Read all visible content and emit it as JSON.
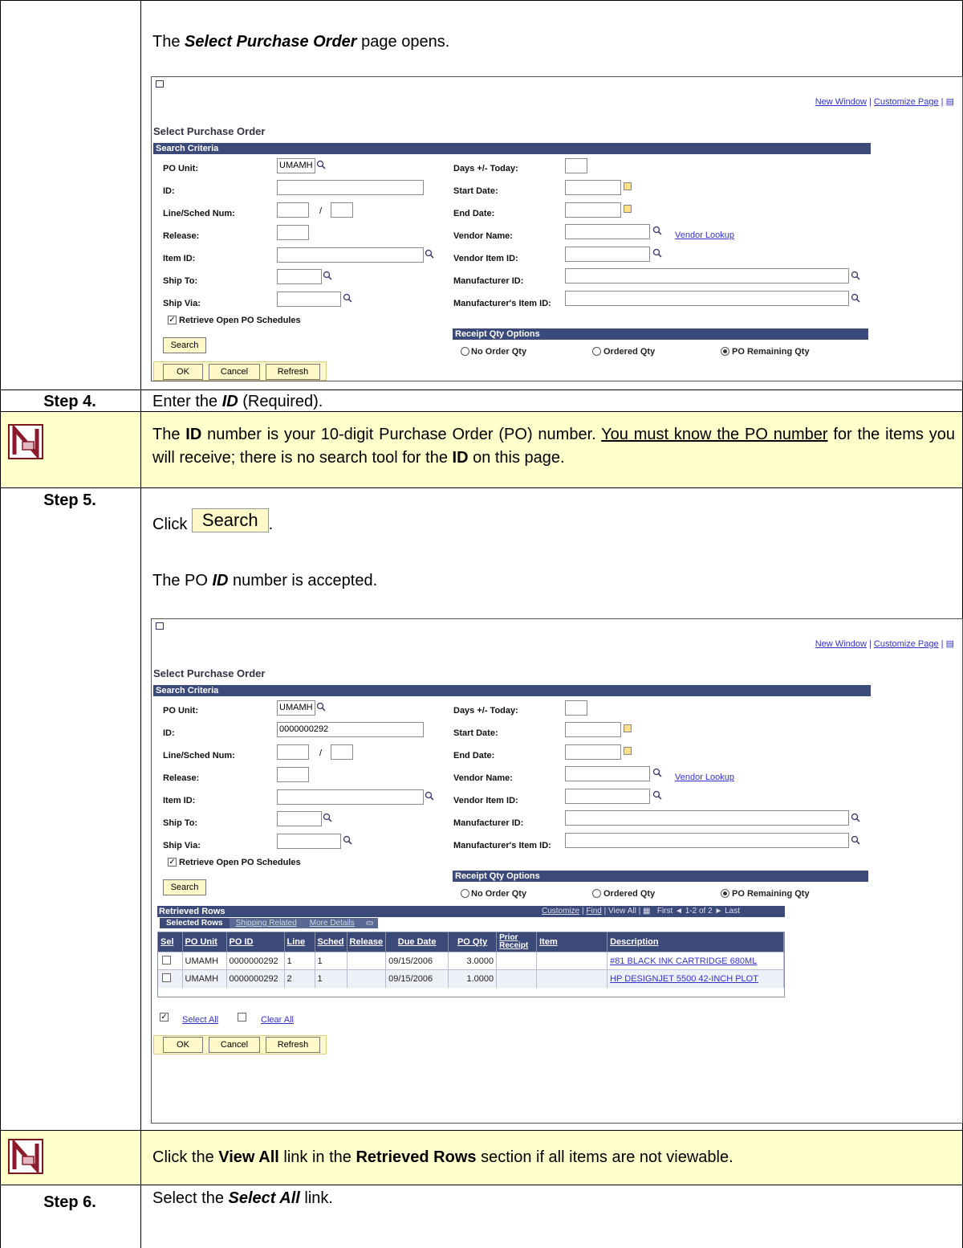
{
  "step3": {
    "intro_pre": "The ",
    "intro_em": "Select Purchase Order",
    "intro_post": " page opens."
  },
  "step4": {
    "label": "Step 4.",
    "pre": "Enter the ",
    "em": "ID",
    "post": " (Required)."
  },
  "note1": {
    "a": "The ",
    "b": "ID",
    "c": " number is your 10-digit Purchase Order (PO) number.  ",
    "d": "You must know the PO number",
    "e": " for the items you will receive; there is no search tool for the ",
    "f": "ID",
    "g": " on this page."
  },
  "step5": {
    "label": "Step 5.",
    "click": "Click ",
    "button": "Search",
    "period": ".",
    "accepted_pre": "The PO ",
    "accepted_em": "ID",
    "accepted_post": " number is accepted."
  },
  "note2": {
    "a": "Click the ",
    "b": "View All",
    "c": " link in the ",
    "d": "Retrieved Rows",
    "e": " section if all items are not viewable."
  },
  "step6": {
    "label": "Step 6.",
    "pre": "Select the ",
    "em": "Select All",
    "post": " link."
  },
  "ps": {
    "new_window": "New Window",
    "customize_page": "Customize Page",
    "sep": "|",
    "title": "Select Purchase Order",
    "search_criteria": "Search Criteria",
    "po_unit_label": "PO Unit:",
    "po_unit_value": "UMAMH",
    "id_label": "ID:",
    "id_value_1": "",
    "id_value_2": "0000000292",
    "line_sched_label": "Line/Sched Num:",
    "slash": "/",
    "release_label": "Release:",
    "item_id_label": "Item ID:",
    "ship_to_label": "Ship To:",
    "ship_via_label": "Ship Via:",
    "retrieve_open": "Retrieve Open PO Schedules",
    "days_label": "Days +/- Today:",
    "start_label": "Start Date:",
    "end_label": "End Date:",
    "vendor_name_label": "Vendor Name:",
    "vendor_lookup": "Vendor Lookup",
    "vendor_item_label": "Vendor Item ID:",
    "manufacturer_id_label": "Manufacturer ID:",
    "manufacturer_item_label": "Manufacturer's Item ID:",
    "receipt_qty_options": "Receipt Qty Options",
    "opt_no_order": "No Order Qty",
    "opt_ordered": "Ordered Qty",
    "opt_remaining": "PO Remaining Qty",
    "search_btn": "Search",
    "ok_btn": "OK",
    "cancel_btn": "Cancel",
    "refresh_btn": "Refresh",
    "retrieved_rows": "Retrieved Rows",
    "grid_nav": {
      "customize": "Customize",
      "find": "Find",
      "view_all": "View All",
      "first": "First",
      "range": "1-2 of 2",
      "last": "Last"
    },
    "tabs": [
      "Selected Rows",
      "Shipping Related",
      "More Details"
    ],
    "columns": [
      "Sel",
      "PO Unit",
      "PO ID",
      "Line",
      "Sched",
      "Release",
      "Due Date",
      "PO Qty",
      "Prior Receipt",
      "Item",
      "Description"
    ],
    "rows": [
      {
        "po_unit": "UMAMH",
        "po_id": "0000000292",
        "line": "1",
        "sched": "1",
        "release": "",
        "due": "09/15/2006",
        "qty": "3.0000",
        "prior": "",
        "item": "",
        "desc": "#81 BLACK INK CARTRIDGE 680ML"
      },
      {
        "po_unit": "UMAMH",
        "po_id": "0000000292",
        "line": "2",
        "sched": "1",
        "release": "",
        "due": "09/15/2006",
        "qty": "1.0000",
        "prior": "",
        "item": "",
        "desc": "HP DESIGNJET 5500 42-INCH PLOT"
      }
    ],
    "select_all": "Select All",
    "clear_all": "Clear All"
  }
}
